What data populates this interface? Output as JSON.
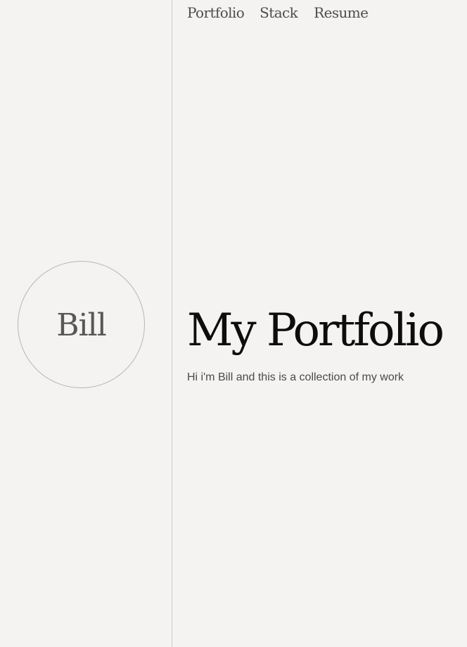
{
  "nav": {
    "items": [
      {
        "label": "Portfolio"
      },
      {
        "label": "Stack"
      },
      {
        "label": "Resume"
      }
    ]
  },
  "sidebar": {
    "avatar_name": "Bill"
  },
  "hero": {
    "title": "My Portfolio",
    "subtitle": "Hi i'm Bill and this is a collection of my work"
  }
}
